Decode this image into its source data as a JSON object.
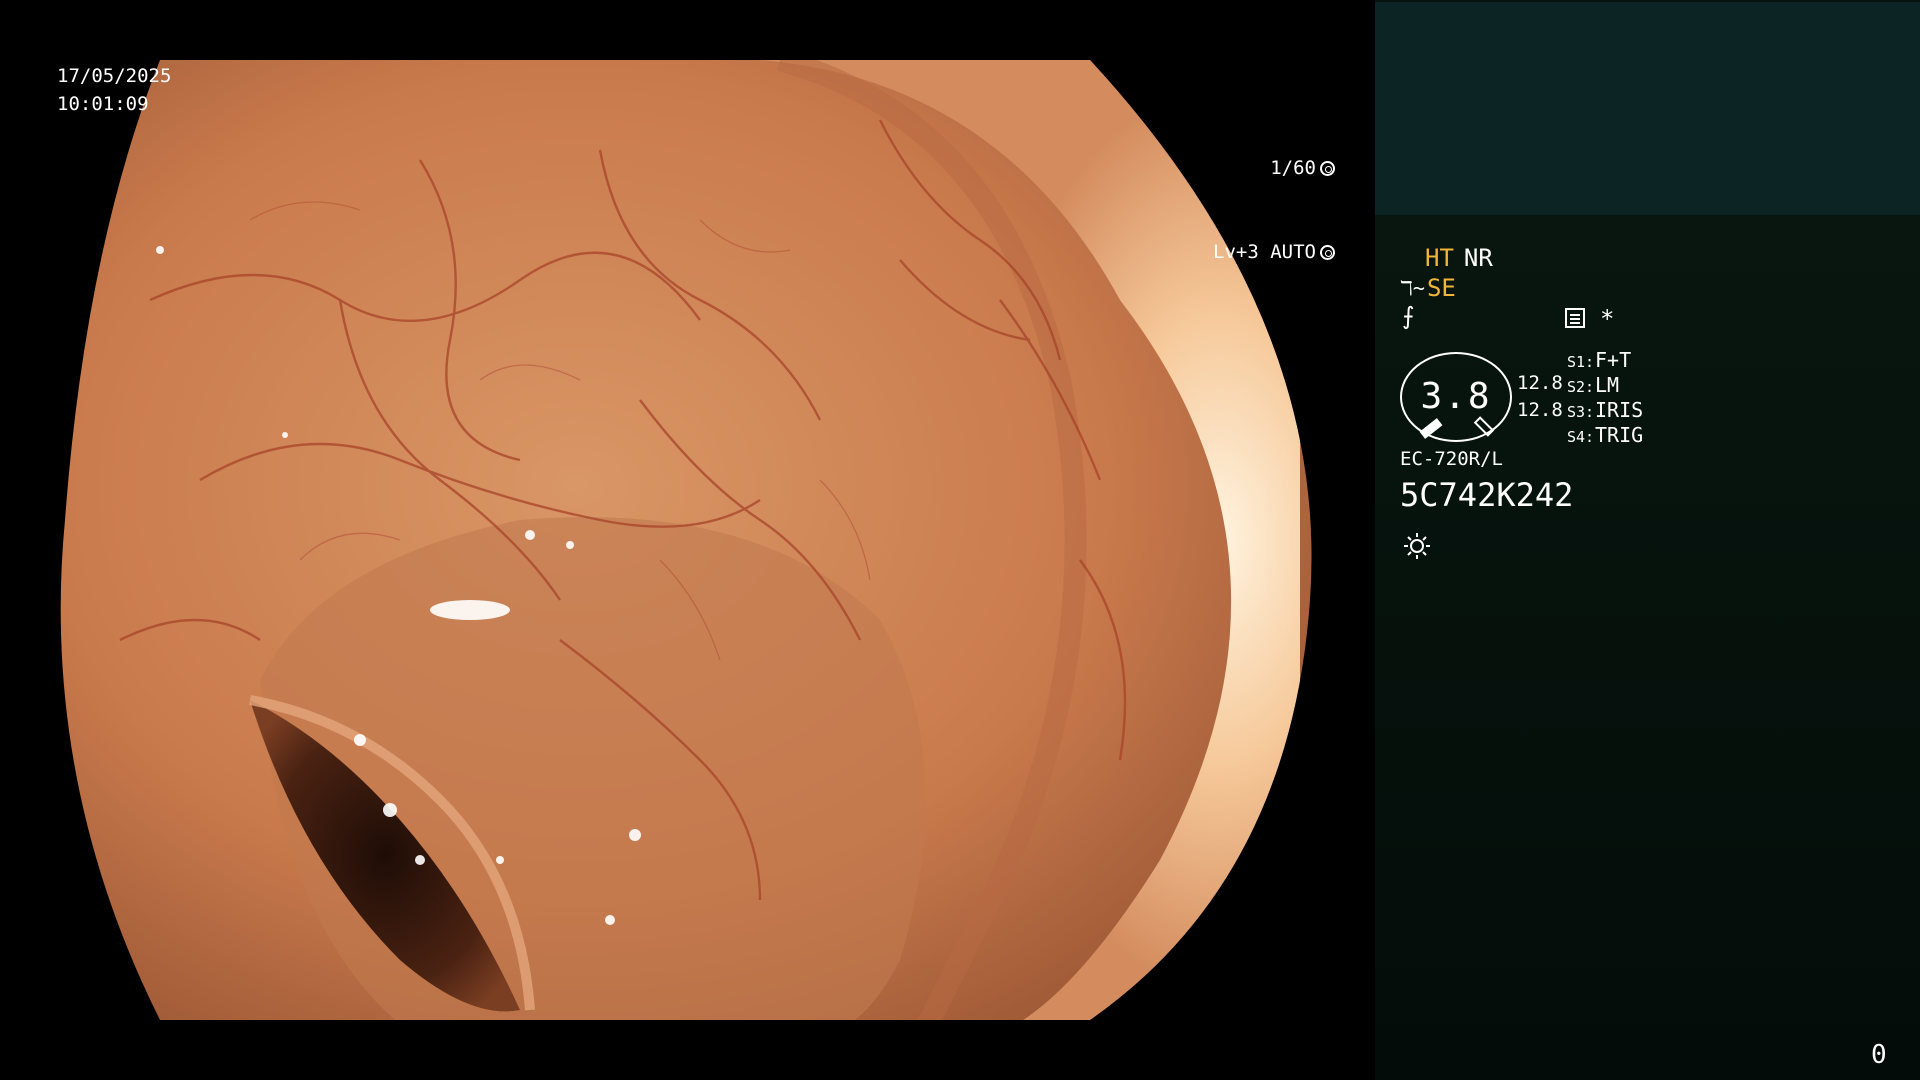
{
  "overlay": {
    "date": "17/05/2025",
    "time": "10:01:09",
    "shutter": "1/60",
    "level": "Lv+3 AUTO"
  },
  "panel": {
    "mode_primary": "HT",
    "mode_secondary": "NR",
    "enhance_mode": "SE",
    "enhance_icon": "f-curve-icon",
    "gauge_value": "3.8",
    "sensitivity_1": "12.8",
    "sensitivity_2": "12.8",
    "switches": [
      {
        "key": "S1:",
        "value": "F+T"
      },
      {
        "key": "S2:",
        "value": "LM"
      },
      {
        "key": "S3:",
        "value": "IRIS"
      },
      {
        "key": "S4:",
        "value": "TRIG"
      }
    ],
    "scope_model": "EC-720R/L",
    "scope_serial": "5C742K242",
    "star": "*",
    "counter": "0"
  },
  "colors": {
    "accent_amber": "#f2b53a",
    "panel_top": "#0d2425",
    "panel_bottom": "#07130f"
  }
}
